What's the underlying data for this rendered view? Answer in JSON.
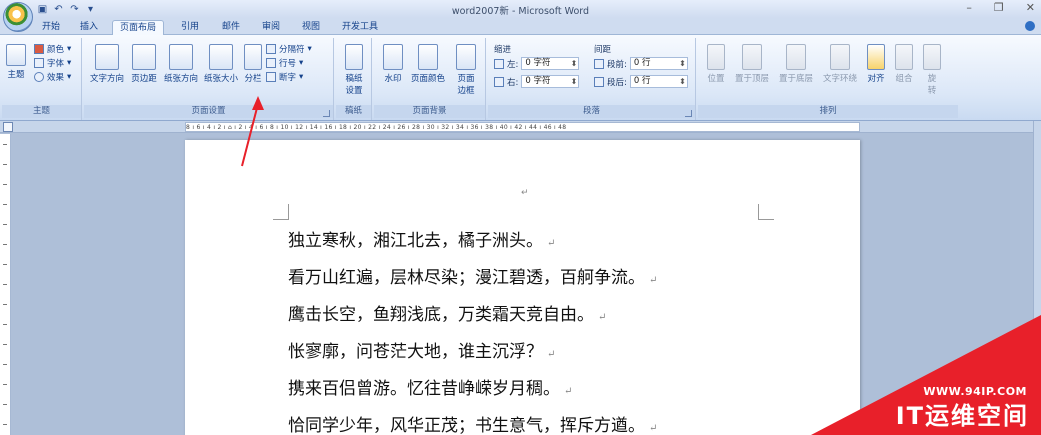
{
  "window": {
    "title": "word2007新 - Microsoft Word",
    "controls": [
      "–",
      "❐",
      "✕"
    ]
  },
  "tabs": [
    "开始",
    "插入",
    "页面布局",
    "引用",
    "邮件",
    "审阅",
    "视图",
    "开发工具"
  ],
  "active_tab": "页面布局",
  "ribbon": {
    "theme_group": {
      "label": "主题",
      "theme_button": "主题",
      "colors": "颜色",
      "fonts": "字体",
      "effects": "效果"
    },
    "page_setup_group": {
      "label": "页面设置",
      "text_direction": "文字方向",
      "margins": "页边距",
      "orientation": "纸张方向",
      "size": "纸张大小",
      "columns": "分栏",
      "breaks": "分隔符",
      "line_numbers": "行号",
      "hyphenation": "断字"
    },
    "draft_group": {
      "label": "稿纸",
      "draft_setup_line1": "稿纸",
      "draft_setup_line2": "设置"
    },
    "page_background_group": {
      "label": "页面背景",
      "watermark": "水印",
      "page_color": "页面颜色",
      "page_borders_line1": "页面",
      "page_borders_line2": "边框"
    },
    "paragraph_group": {
      "label": "段落",
      "indent_title": "缩进",
      "indent_left_label": "左:",
      "indent_left_value": "0 字符",
      "indent_right_label": "右:",
      "indent_right_value": "0 字符",
      "spacing_title": "间距",
      "spacing_before_label": "段前:",
      "spacing_before_value": "0 行",
      "spacing_after_label": "段后:",
      "spacing_after_value": "0 行"
    },
    "arrange_group": {
      "label": "排列",
      "position": "位置",
      "bring_front": "置于顶层",
      "send_back": "置于底层",
      "text_wrap": "文字环绕",
      "align": "对齐",
      "group": "组合",
      "rotate_line1": "旋",
      "rotate_line2": "转"
    }
  },
  "ruler_text": "8 ı  6 ı  4 ı  2 ı  ⌂  ı  2 ı  4 ı  6 ı  8 ı  10 ı  12 ı  14 ı  16 ı  18 ı  20 ı  22 ı  24 ı  26 ı  28 ı  30 ı  32 ı  34 ı  36 ı  38 ı  40 ı  42 ı  44 ı  46 ı  48",
  "document": {
    "lines": [
      "独立寒秋，湘江北去，橘子洲头。",
      "看万山红遍，层林尽染；漫江碧透，百舸争流。",
      "鹰击长空，鱼翔浅底，万类霜天竞自由。",
      "怅寥廓，问苍茫大地，谁主沉浮？",
      "携来百侣曾游。忆往昔峥嵘岁月稠。",
      "恰同学少年，风华正茂；书生意气，挥斥方遒。"
    ],
    "paragraph_mark": "↵"
  },
  "watermark": {
    "url": "WWW.94IP.COM",
    "text": "IT运维空间"
  },
  "colors": {
    "annotation_arrow": "#e8202a",
    "watermark_bg": "#e8202a"
  }
}
